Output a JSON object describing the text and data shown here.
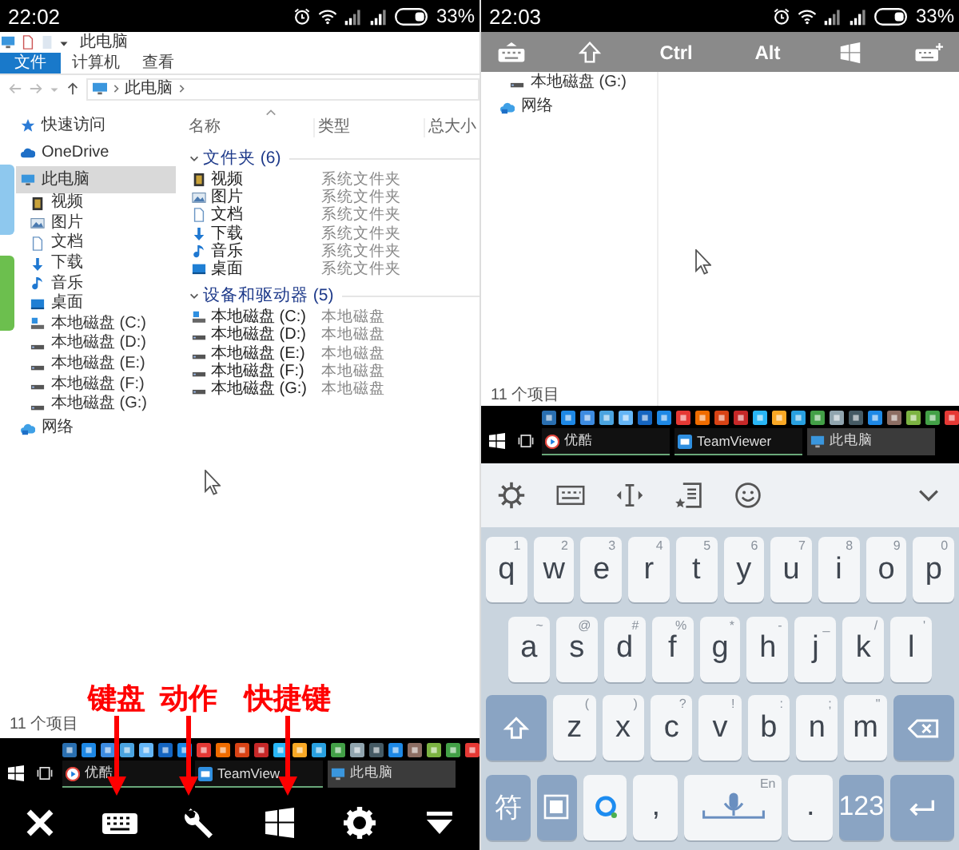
{
  "left_screen": {
    "status_bar": {
      "time": "22:02",
      "battery": "33%"
    },
    "explorer": {
      "title": "此电脑",
      "ribbon_tabs": [
        {
          "label": "文件",
          "selected": true
        },
        {
          "label": "计算机",
          "selected": false
        },
        {
          "label": "查看",
          "selected": false
        }
      ],
      "address": "此电脑",
      "navigation": [
        {
          "label": "快速访问",
          "kind": "star",
          "selected": false
        },
        {
          "label": "OneDrive",
          "kind": "cloud",
          "selected": false
        },
        {
          "label": "此电脑",
          "kind": "pc",
          "selected": true,
          "children": [
            {
              "label": "视频",
              "kind": "video",
              "selected": false
            },
            {
              "label": "图片",
              "kind": "picture",
              "selected": false
            },
            {
              "label": "文档",
              "kind": "document",
              "selected": false
            },
            {
              "label": "下载",
              "kind": "download",
              "selected": false
            },
            {
              "label": "音乐",
              "kind": "music",
              "selected": false
            },
            {
              "label": "桌面",
              "kind": "desktop",
              "selected": false
            },
            {
              "label": "本地磁盘 (C:)",
              "kind": "system-drive",
              "selected": false
            },
            {
              "label": "本地磁盘 (D:)",
              "kind": "drive",
              "selected": false
            },
            {
              "label": "本地磁盘 (E:)",
              "kind": "drive",
              "selected": false
            },
            {
              "label": "本地磁盘 (F:)",
              "kind": "drive",
              "selected": false
            },
            {
              "label": "本地磁盘 (G:)",
              "kind": "drive",
              "selected": false
            }
          ]
        },
        {
          "label": "网络",
          "kind": "network",
          "selected": false
        }
      ],
      "columns": [
        "名称",
        "类型",
        "总大小"
      ],
      "groups": [
        {
          "title": "文件夹 (6)",
          "expanded": true,
          "items": [
            {
              "name": "视频",
              "type": "系统文件夹",
              "kind": "video"
            },
            {
              "name": "图片",
              "type": "系统文件夹",
              "kind": "picture"
            },
            {
              "name": "文档",
              "type": "系统文件夹",
              "kind": "document"
            },
            {
              "name": "下载",
              "type": "系统文件夹",
              "kind": "download"
            },
            {
              "name": "音乐",
              "type": "系统文件夹",
              "kind": "music"
            },
            {
              "name": "桌面",
              "type": "系统文件夹",
              "kind": "desktop"
            }
          ]
        },
        {
          "title": "设备和驱动器 (5)",
          "expanded": true,
          "items": [
            {
              "name": "本地磁盘 (C:)",
              "type": "本地磁盘",
              "kind": "system-drive"
            },
            {
              "name": "本地磁盘 (D:)",
              "type": "本地磁盘",
              "kind": "drive"
            },
            {
              "name": "本地磁盘 (E:)",
              "type": "本地磁盘",
              "kind": "drive"
            },
            {
              "name": "本地磁盘 (F:)",
              "type": "本地磁盘",
              "kind": "drive"
            },
            {
              "name": "本地磁盘 (G:)",
              "type": "本地磁盘",
              "kind": "drive"
            }
          ]
        }
      ],
      "status": "11 个项目"
    },
    "taskbar": {
      "tasks": [
        {
          "label": "优酷",
          "kind": "youku",
          "selected": false
        },
        {
          "label": "TeamView",
          "kind": "teamviewer",
          "selected": false
        },
        {
          "label": "此电脑",
          "kind": "pc",
          "selected": true
        }
      ]
    },
    "annotations": [
      {
        "label": "键盘"
      },
      {
        "label": "动作"
      },
      {
        "label": "快捷键"
      }
    ]
  },
  "right_screen": {
    "status_bar": {
      "time": "22:03",
      "battery": "33%"
    },
    "shortcut_keys": [
      {
        "kind": "keyboard"
      },
      {
        "kind": "shift"
      },
      {
        "kind": "text",
        "label": "Ctrl"
      },
      {
        "kind": "text",
        "label": "Alt"
      },
      {
        "kind": "windows"
      },
      {
        "kind": "keyboard-plus"
      }
    ],
    "explorer": {
      "navigation": [
        {
          "label": "本地磁盘 (G:)",
          "kind": "drive",
          "selected": false
        },
        {
          "label": "网络",
          "kind": "network",
          "selected": false
        }
      ],
      "status": "11 个项目"
    },
    "taskbar": {
      "tasks": [
        {
          "label": "优酷",
          "kind": "youku",
          "selected": false
        },
        {
          "label": "TeamViewer",
          "kind": "teamviewer",
          "selected": false
        },
        {
          "label": "此电脑",
          "kind": "pc",
          "selected": true
        }
      ]
    },
    "keyboard": {
      "rows": [
        {
          "keys": [
            {
              "kind": "char",
              "label": "q",
              "hint": "1"
            },
            {
              "kind": "char",
              "label": "w",
              "hint": "2"
            },
            {
              "kind": "char",
              "label": "e",
              "hint": "3"
            },
            {
              "kind": "char",
              "label": "r",
              "hint": "4"
            },
            {
              "kind": "char",
              "label": "t",
              "hint": "5"
            },
            {
              "kind": "char",
              "label": "y",
              "hint": "6"
            },
            {
              "kind": "char",
              "label": "u",
              "hint": "7"
            },
            {
              "kind": "char",
              "label": "i",
              "hint": "8"
            },
            {
              "kind": "char",
              "label": "o",
              "hint": "9"
            },
            {
              "kind": "char",
              "label": "p",
              "hint": "0"
            }
          ]
        },
        {
          "keys": [
            {
              "kind": "char",
              "label": "a",
              "hint": "~"
            },
            {
              "kind": "char",
              "label": "s",
              "hint": "@"
            },
            {
              "kind": "char",
              "label": "d",
              "hint": "#"
            },
            {
              "kind": "char",
              "label": "f",
              "hint": "%"
            },
            {
              "kind": "char",
              "label": "g",
              "hint": "*"
            },
            {
              "kind": "char",
              "label": "h",
              "hint": "-"
            },
            {
              "kind": "char",
              "label": "j",
              "hint": "_"
            },
            {
              "kind": "char",
              "label": "k",
              "hint": "/"
            },
            {
              "kind": "char",
              "label": "l",
              "hint": "'"
            }
          ]
        },
        {
          "keys": [
            {
              "kind": "shift"
            },
            {
              "kind": "char",
              "label": "z",
              "hint": "("
            },
            {
              "kind": "char",
              "label": "x",
              "hint": ")"
            },
            {
              "kind": "char",
              "label": "c",
              "hint": "?"
            },
            {
              "kind": "char",
              "label": "v",
              "hint": "!"
            },
            {
              "kind": "char",
              "label": "b",
              "hint": ":"
            },
            {
              "kind": "char",
              "label": "n",
              "hint": ";"
            },
            {
              "kind": "char",
              "label": "m",
              "hint": "\""
            },
            {
              "kind": "backspace"
            }
          ]
        },
        {
          "keys": [
            {
              "kind": "fn",
              "label": "符"
            },
            {
              "kind": "layout"
            },
            {
              "kind": "logo"
            },
            {
              "kind": "char",
              "label": ","
            },
            {
              "kind": "space",
              "hint": "En"
            },
            {
              "kind": "char",
              "label": "."
            },
            {
              "kind": "fn",
              "label": "123"
            },
            {
              "kind": "enter"
            }
          ]
        }
      ]
    }
  }
}
